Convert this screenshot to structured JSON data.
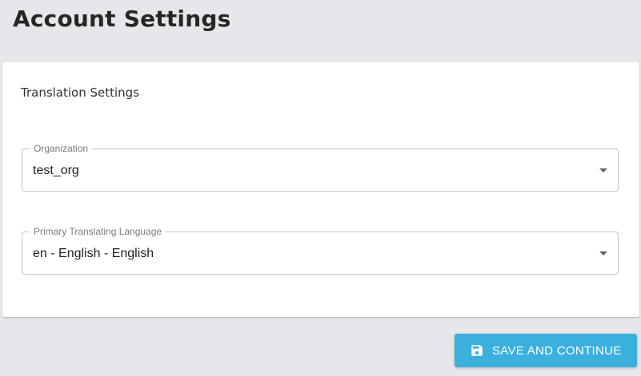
{
  "page": {
    "title": "Account Settings"
  },
  "card": {
    "title": "Translation Settings"
  },
  "fields": {
    "organization": {
      "label": "Organization",
      "value": "test_org"
    },
    "primary_language": {
      "label": "Primary Translating Language",
      "value": "en - English - English"
    }
  },
  "actions": {
    "save_label": "SAVE AND CONTINUE",
    "save_icon": "floppy-disk-icon"
  },
  "colors": {
    "background": "#e6e7eb",
    "card": "#ffffff",
    "accent": "#3cb0dd"
  }
}
